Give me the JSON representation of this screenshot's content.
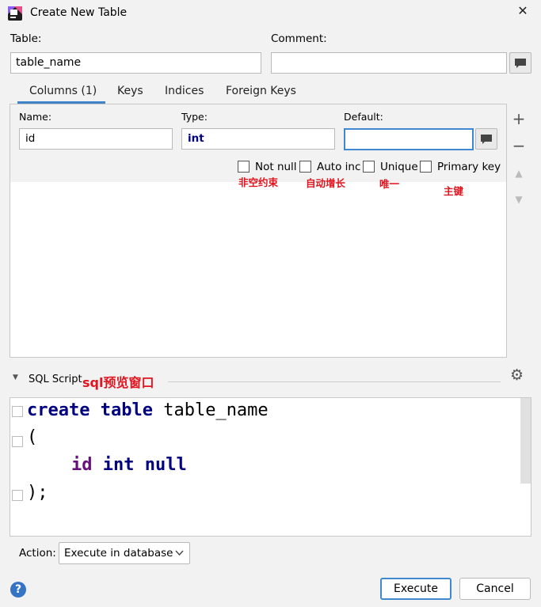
{
  "window": {
    "title": "Create New Table"
  },
  "table": {
    "label": "Table:",
    "value": "table_name"
  },
  "comment": {
    "label": "Comment:",
    "value": ""
  },
  "tabs": [
    {
      "label": "Columns (1)",
      "active": true
    },
    {
      "label": "Keys"
    },
    {
      "label": "Indices"
    },
    {
      "label": "Foreign Keys"
    }
  ],
  "column": {
    "name_label": "Name:",
    "name_value": "id",
    "type_label": "Type:",
    "type_value": "int",
    "default_label": "Default:",
    "default_value": ""
  },
  "checkboxes": [
    {
      "label": "Not null",
      "checked": false,
      "annotation": "非空约束"
    },
    {
      "label": "Auto inc",
      "checked": false,
      "annotation": "自动增长"
    },
    {
      "label": "Unique",
      "checked": false,
      "annotation": "唯一"
    },
    {
      "label": "Primary key",
      "checked": false,
      "annotation": "主键"
    }
  ],
  "sql": {
    "label": "SQL Script",
    "annotation": "sql预览窗口",
    "lines": [
      "create table table_name",
      "(",
      "id int null",
      ");"
    ]
  },
  "code": {
    "kw_create": "create",
    "kw_table": "table",
    "table_ident": "table_name",
    "open_paren": "(",
    "col_ident": "id",
    "kw_int": "int",
    "kw_null": "null",
    "close": ");"
  },
  "action": {
    "label": "Action:",
    "selected": "Execute in database"
  },
  "buttons": {
    "execute": "Execute",
    "cancel": "Cancel"
  },
  "icons": {
    "help": "?",
    "close": "✕",
    "add": "+",
    "remove": "−",
    "up": "▲",
    "down": "▼",
    "collapse": "▼",
    "gear": "⚙"
  },
  "colors": {
    "accent": "#3f88d0",
    "annotation": "#e0151f",
    "keyword": "#000080",
    "identifier": "#660e7a"
  }
}
